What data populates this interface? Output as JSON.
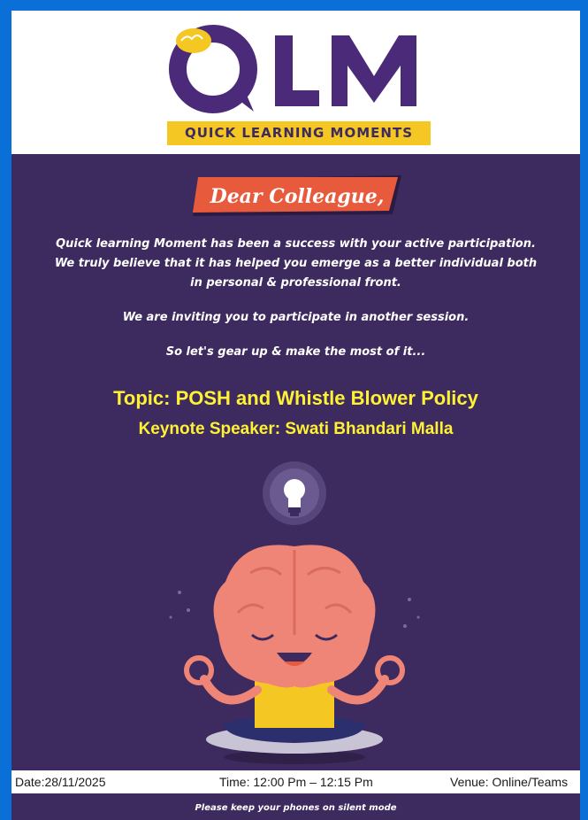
{
  "logo": {
    "letters": "QLM",
    "tagline": "QUICK LEARNING MOMENTS"
  },
  "banner": {
    "text": "Dear Colleague,"
  },
  "message": {
    "line1": "Quick learning Moment has been a success with your active participation.",
    "line2": "We truly believe that it has helped you emerge as a better individual both",
    "line3": "in personal & professional front.",
    "line4": "We are inviting you to participate in another session.",
    "line5": "So let's gear up & make the most of it..."
  },
  "topic": {
    "label": "Topic:",
    "value": "POSH and Whistle Blower Policy"
  },
  "speaker": {
    "label": "Keynote  Speaker:",
    "value": "Swati Bhandari Malla"
  },
  "footer": {
    "date": "Date:28/11/2025",
    "time": "Time: 12:00 Pm – 12:15 Pm",
    "venue": "Venue: Online/Teams"
  },
  "note": "Please keep your phones on silent mode",
  "colors": {
    "background": "#3d2a5e",
    "accent_yellow": "#f5c722",
    "highlight_text": "#fff234",
    "banner": "#e85a3c",
    "brain": "#ef8577",
    "frame": "#0a6fd6"
  }
}
